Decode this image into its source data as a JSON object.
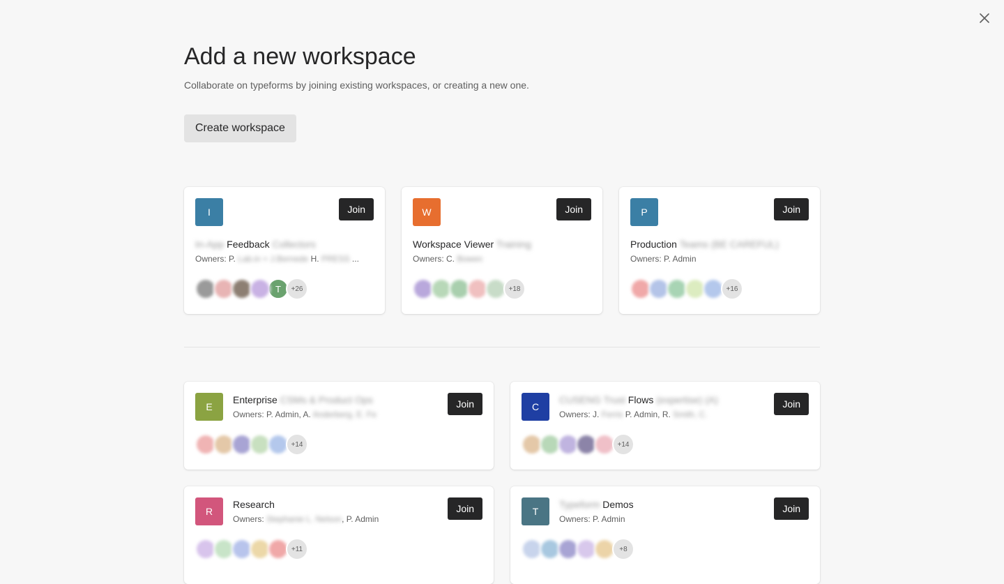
{
  "header": {
    "title": "Add a new workspace",
    "subtitle": "Collaborate on typeforms by joining existing workspaces, or creating a new one.",
    "create_label": "Create workspace"
  },
  "colors": {
    "join_bg": "#262627",
    "background": "#f7f7f7"
  },
  "featured": [
    {
      "initial": "I",
      "color": "#3b7fa5",
      "name_hidden_pre": "In-App ",
      "name": "Feedback",
      "name_hidden_post": " Collectors",
      "owners_label": "Owners: P.",
      "owners_hidden": " Lab.in + J.Bernede",
      "owners_tail": " H.",
      "owners_hidden2": " PRESS",
      "owners_end": " ...",
      "join_label": "Join",
      "more": "+26",
      "visible_avatar": "T",
      "visible_avatar_color": "#6aa26e"
    },
    {
      "initial": "W",
      "color": "#e76e2f",
      "name_hidden_pre": "",
      "name": "Workspace Viewer",
      "name_hidden_post": " Training",
      "owners_label": "Owners: C.",
      "owners_hidden": " Bowen",
      "owners_tail": "",
      "owners_hidden2": "",
      "owners_end": "",
      "join_label": "Join",
      "more": "+18",
      "visible_avatar": "",
      "visible_avatar_color": ""
    },
    {
      "initial": "P",
      "color": "#3b7fa5",
      "name_hidden_pre": "",
      "name": "Production",
      "name_hidden_post": " Teams (BE CAREFUL)",
      "owners_label": "Owners: P. Admin",
      "owners_hidden": "",
      "owners_tail": "",
      "owners_hidden2": "",
      "owners_end": "",
      "join_label": "Join",
      "more": "+16",
      "visible_avatar": "",
      "visible_avatar_color": ""
    }
  ],
  "others": [
    {
      "initial": "E",
      "color": "#8ba342",
      "name_hidden_pre": "",
      "name": "Enterprise",
      "name_hidden_post": " CSMs & Product Ops",
      "owners_label": "Owners: P. Admin, A.",
      "owners_hidden": " Anderberg, E. Fe",
      "join_label": "Join",
      "more": "+14"
    },
    {
      "initial": "C",
      "color": "#1f3fa3",
      "name_hidden_pre": "CUSENG Trust ",
      "name": "Flows",
      "name_hidden_post": " (expertise) (A)",
      "owners_label": "Owners: J.",
      "owners_hidden": " Ferris",
      "owners_tail": " P. Admin, R.",
      "owners_hidden2": " Smith, C.",
      "join_label": "Join",
      "more": "+14"
    },
    {
      "initial": "R",
      "color": "#d2567c",
      "name_hidden_pre": "",
      "name": "Research",
      "name_hidden_post": "",
      "owners_label": "Owners:",
      "owners_hidden": " Stephanie L. Nelson",
      "owners_tail": ", P. Admin",
      "owners_hidden2": "",
      "join_label": "Join",
      "more": "+11"
    },
    {
      "initial": "T",
      "color": "#4a7584",
      "name_hidden_pre": "Typeform ",
      "name": "Demos",
      "name_hidden_post": "",
      "owners_label": "Owners: P. Admin",
      "owners_hidden": "",
      "owners_tail": "",
      "owners_hidden2": "",
      "join_label": "Join",
      "more": "+8"
    }
  ]
}
